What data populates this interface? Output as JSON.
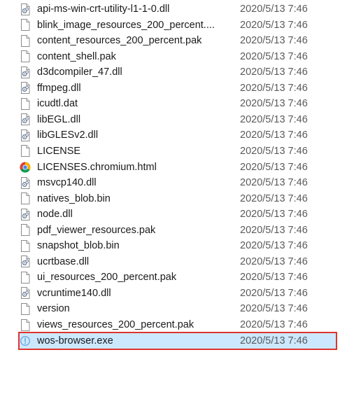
{
  "colors": {
    "selection_background": "#cce8ff",
    "selection_outline": "#e0332d",
    "date_text": "#5a5a5a"
  },
  "files": [
    {
      "name": "api-ms-win-crt-utility-l1-1-0.dll",
      "modified": "2020/5/13 7:46",
      "icon": "dll-file-icon"
    },
    {
      "name": "blink_image_resources_200_percent....",
      "modified": "2020/5/13 7:46",
      "icon": "blank-file-icon"
    },
    {
      "name": "content_resources_200_percent.pak",
      "modified": "2020/5/13 7:46",
      "icon": "blank-file-icon"
    },
    {
      "name": "content_shell.pak",
      "modified": "2020/5/13 7:46",
      "icon": "blank-file-icon"
    },
    {
      "name": "d3dcompiler_47.dll",
      "modified": "2020/5/13 7:46",
      "icon": "dll-file-icon"
    },
    {
      "name": "ffmpeg.dll",
      "modified": "2020/5/13 7:46",
      "icon": "dll-file-icon"
    },
    {
      "name": "icudtl.dat",
      "modified": "2020/5/13 7:46",
      "icon": "blank-file-icon"
    },
    {
      "name": "libEGL.dll",
      "modified": "2020/5/13 7:46",
      "icon": "dll-file-icon"
    },
    {
      "name": "libGLESv2.dll",
      "modified": "2020/5/13 7:46",
      "icon": "dll-file-icon"
    },
    {
      "name": "LICENSE",
      "modified": "2020/5/13 7:46",
      "icon": "blank-file-icon"
    },
    {
      "name": "LICENSES.chromium.html",
      "modified": "2020/5/13 7:46",
      "icon": "chrome-icon"
    },
    {
      "name": "msvcp140.dll",
      "modified": "2020/5/13 7:46",
      "icon": "dll-file-icon"
    },
    {
      "name": "natives_blob.bin",
      "modified": "2020/5/13 7:46",
      "icon": "blank-file-icon"
    },
    {
      "name": "node.dll",
      "modified": "2020/5/13 7:46",
      "icon": "dll-file-icon"
    },
    {
      "name": "pdf_viewer_resources.pak",
      "modified": "2020/5/13 7:46",
      "icon": "blank-file-icon"
    },
    {
      "name": "snapshot_blob.bin",
      "modified": "2020/5/13 7:46",
      "icon": "blank-file-icon"
    },
    {
      "name": "ucrtbase.dll",
      "modified": "2020/5/13 7:46",
      "icon": "dll-file-icon"
    },
    {
      "name": "ui_resources_200_percent.pak",
      "modified": "2020/5/13 7:46",
      "icon": "blank-file-icon"
    },
    {
      "name": "vcruntime140.dll",
      "modified": "2020/5/13 7:46",
      "icon": "dll-file-icon"
    },
    {
      "name": "version",
      "modified": "2020/5/13 7:46",
      "icon": "blank-file-icon"
    },
    {
      "name": "views_resources_200_percent.pak",
      "modified": "2020/5/13 7:46",
      "icon": "blank-file-icon"
    },
    {
      "name": "wos-browser.exe",
      "modified": "2020/5/13 7:46",
      "icon": "exe-app-icon",
      "selected": true
    }
  ]
}
